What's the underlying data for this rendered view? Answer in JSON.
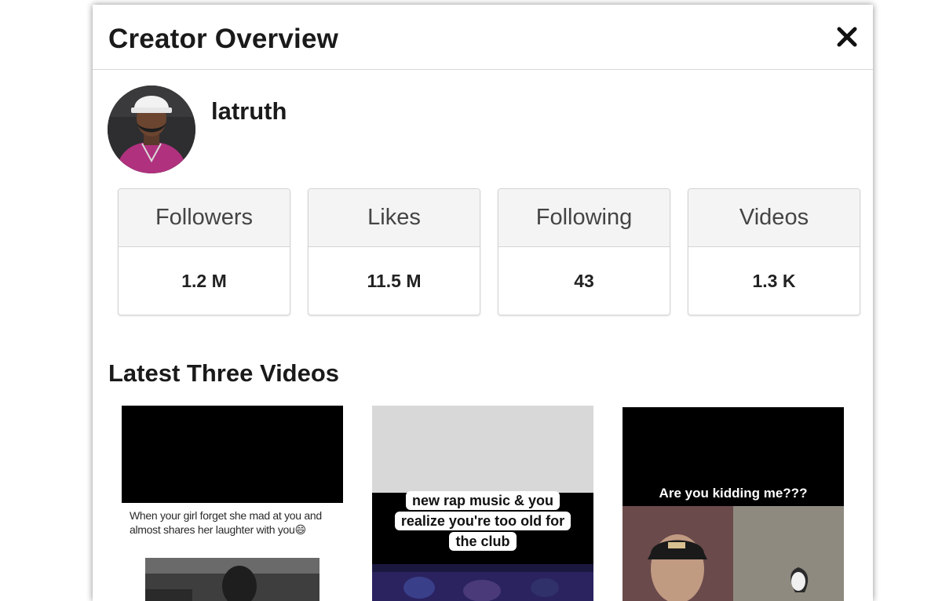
{
  "modal": {
    "title": "Creator Overview",
    "close_icon": "close-icon"
  },
  "creator": {
    "username": "latruth",
    "avatar_icon": "avatar"
  },
  "stats": [
    {
      "label": "Followers",
      "value": "1.2 M"
    },
    {
      "label": "Likes",
      "value": "11.5 M"
    },
    {
      "label": "Following",
      "value": "43"
    },
    {
      "label": "Videos",
      "value": "1.3 K"
    }
  ],
  "latest_videos": {
    "title": "Latest Three Videos",
    "items": [
      {
        "caption": "When your girl forget she mad at you and almost shares her laughter with you😄"
      },
      {
        "caption": "new rap music & you realize you're too old for the club"
      },
      {
        "caption": "Are you kidding me???"
      }
    ]
  },
  "colors": {
    "background": "#ffffff",
    "stat_header_bg": "#f4f4f4",
    "border": "#d4d4d4",
    "text": "#1a1a1a"
  }
}
